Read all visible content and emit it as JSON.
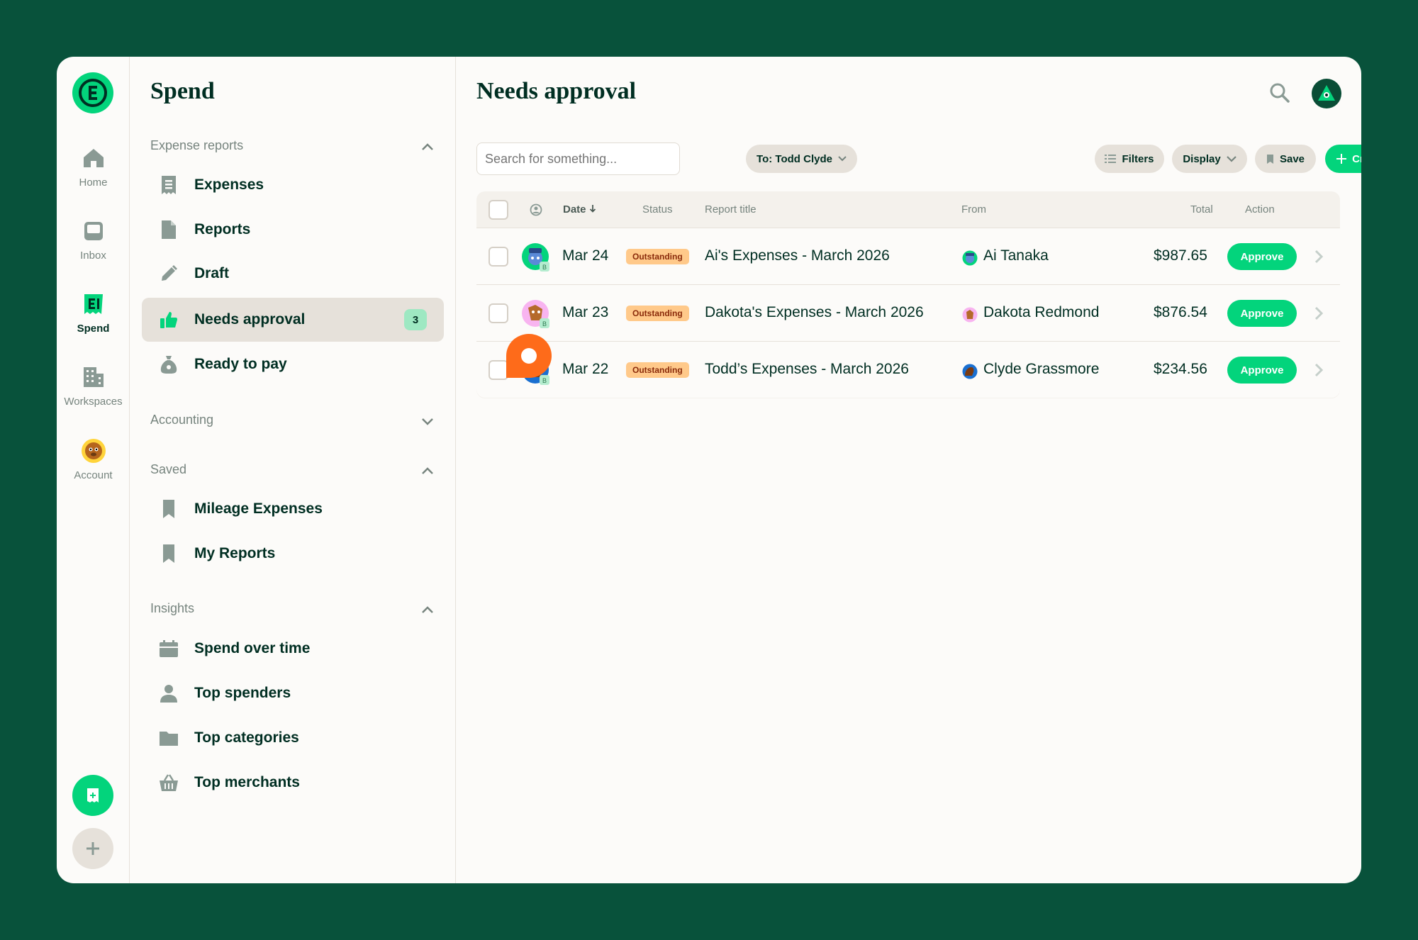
{
  "rail": {
    "items": [
      {
        "label": "Home",
        "icon": "home-icon"
      },
      {
        "label": "Inbox",
        "icon": "inbox-icon"
      },
      {
        "label": "Spend",
        "icon": "receipt-icon"
      },
      {
        "label": "Workspaces",
        "icon": "building-icon"
      },
      {
        "label": "Account",
        "icon": "avatar-icon"
      }
    ],
    "active": "Spend"
  },
  "sidebar": {
    "title": "Spend",
    "sections": [
      {
        "label": "Expense reports",
        "items": [
          {
            "label": "Expenses",
            "icon": "receipt-icon"
          },
          {
            "label": "Reports",
            "icon": "document-icon"
          },
          {
            "label": "Draft",
            "icon": "pencil-icon"
          },
          {
            "label": "Needs approval",
            "icon": "thumbs-up-icon",
            "badge": "3"
          },
          {
            "label": "Ready to pay",
            "icon": "money-bag-icon"
          }
        ]
      },
      {
        "label": "Accounting",
        "items": []
      },
      {
        "label": "Saved",
        "items": [
          {
            "label": "Mileage Expenses",
            "icon": "bookmark-icon"
          },
          {
            "label": "My Reports",
            "icon": "bookmark-icon"
          }
        ]
      },
      {
        "label": "Insights",
        "items": [
          {
            "label": "Spend over time",
            "icon": "calendar-icon"
          },
          {
            "label": "Top spenders",
            "icon": "user-icon"
          },
          {
            "label": "Top categories",
            "icon": "folder-icon"
          },
          {
            "label": "Top merchants",
            "icon": "basket-icon"
          }
        ]
      }
    ]
  },
  "main": {
    "title": "Needs approval",
    "search_placeholder": "Search for something...",
    "to_filter": "To: Todd Clyde",
    "filters_label": "Filters",
    "display_label": "Display",
    "save_label": "Save",
    "create_label": "Create",
    "columns": {
      "date": "Date",
      "status": "Status",
      "title": "Report title",
      "from": "From",
      "total": "Total",
      "action": "Action"
    },
    "rows": [
      {
        "date": "Mar 24",
        "status": "Outstanding",
        "title": "Ai's Expenses - March 2026",
        "from": "Ai Tanaka",
        "total": "$987.65",
        "action": "Approve"
      },
      {
        "date": "Mar 23",
        "status": "Outstanding",
        "title": "Dakota's Expenses - March 2026",
        "from": "Dakota Redmond",
        "total": "$876.54",
        "action": "Approve"
      },
      {
        "date": "Mar 22",
        "status": "Outstanding",
        "title": "Todd’s Expenses - March 2026",
        "from": "Clyde Grassmore",
        "total": "$234.56",
        "action": "Approve"
      }
    ]
  },
  "colors": {
    "background": "#08523b",
    "accent": "#03d47c",
    "status_bg": "#ffc98a",
    "tooltip": "#fe6b1a"
  }
}
